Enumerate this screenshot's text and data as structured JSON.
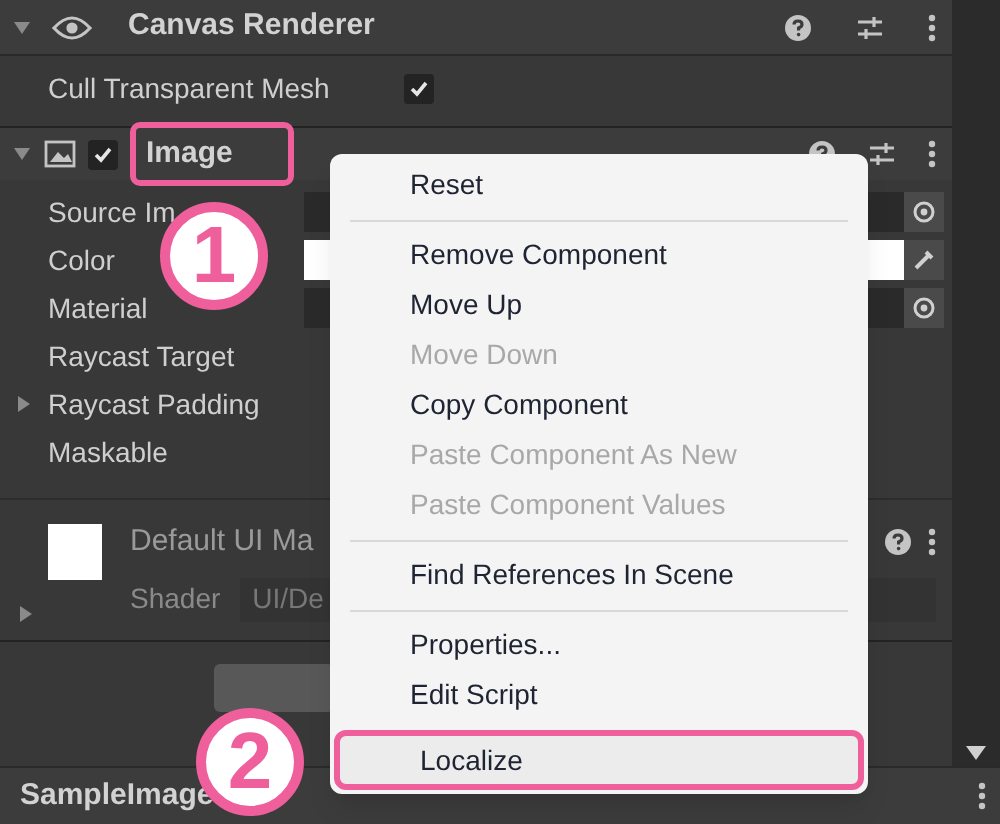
{
  "canvas_renderer": {
    "title": "Canvas Renderer",
    "expanded": true,
    "fields": [
      {
        "label": "Cull Transparent Mesh",
        "checked": true
      }
    ]
  },
  "image_component": {
    "title": "Image",
    "enabled": true,
    "expanded": true,
    "highlighted": true,
    "fields": [
      {
        "label": "Source Im",
        "kind": "object"
      },
      {
        "label": "Color",
        "kind": "color"
      },
      {
        "label": "Material",
        "kind": "object"
      },
      {
        "label": "Raycast Target",
        "kind": "plain"
      },
      {
        "label": "Raycast Padding",
        "kind": "foldout",
        "expanded": false
      },
      {
        "label": "Maskable",
        "kind": "plain"
      }
    ]
  },
  "material": {
    "name": "Default UI Ma",
    "shader_label": "Shader",
    "shader_value": "UI/De",
    "expanded": false
  },
  "next_component": {
    "title": "SampleImage"
  },
  "context_menu": {
    "items": [
      {
        "kind": "item",
        "label": "Reset",
        "disabled": false,
        "selected": false
      },
      {
        "kind": "separator"
      },
      {
        "kind": "item",
        "label": "Remove Component",
        "disabled": false,
        "selected": false
      },
      {
        "kind": "item",
        "label": "Move Up",
        "disabled": false,
        "selected": false
      },
      {
        "kind": "item",
        "label": "Move Down",
        "disabled": true,
        "selected": false
      },
      {
        "kind": "item",
        "label": "Copy Component",
        "disabled": false,
        "selected": false
      },
      {
        "kind": "item",
        "label": "Paste Component As New",
        "disabled": true,
        "selected": false
      },
      {
        "kind": "item",
        "label": "Paste Component Values",
        "disabled": true,
        "selected": false
      },
      {
        "kind": "separator"
      },
      {
        "kind": "item",
        "label": "Find References In Scene",
        "disabled": false,
        "selected": false
      },
      {
        "kind": "separator"
      },
      {
        "kind": "item",
        "label": "Properties...",
        "disabled": false,
        "selected": false
      },
      {
        "kind": "item",
        "label": "Edit Script",
        "disabled": false,
        "selected": false
      },
      {
        "kind": "item",
        "label": "Localize",
        "disabled": false,
        "selected": true
      }
    ]
  },
  "annotations": [
    {
      "label": "1"
    },
    {
      "label": "2"
    }
  ]
}
